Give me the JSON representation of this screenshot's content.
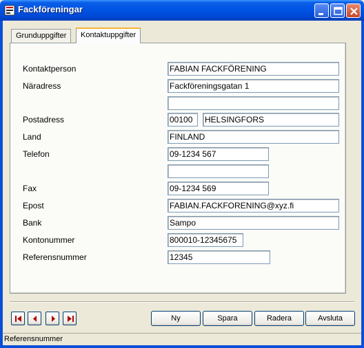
{
  "window": {
    "title": "Fackföreningar"
  },
  "tabs": [
    {
      "label": "Grunduppgifter"
    },
    {
      "label": "Kontaktuppgifter"
    }
  ],
  "form": {
    "contact_person_label": "Kontaktperson",
    "contact_person_value": "FABIAN FACKFÖRENING",
    "street_label": "Näradress",
    "street_value": "Fackföreningsgatan 1",
    "street2_value": "",
    "postal_label": "Postadress",
    "postal_code_value": "00100",
    "postal_city_value": "HELSINGFORS",
    "country_label": "Land",
    "country_value": "FINLAND",
    "phone_label": "Telefon",
    "phone_value": "09-1234 567",
    "phone2_value": "",
    "fax_label": "Fax",
    "fax_value": "09-1234 569",
    "email_label": "Epost",
    "email_value": "FABIAN.FACKFORENING@xyz.fi",
    "bank_label": "Bank",
    "bank_value": "Sampo",
    "account_label": "Kontonummer",
    "account_value": "800010-12345675",
    "reference_label": "Referensnummer",
    "reference_value": "12345"
  },
  "buttons": {
    "new": "Ny",
    "save": "Spara",
    "delete": "Radera",
    "exit": "Avsluta"
  },
  "nav_icons": [
    "first-record-icon",
    "previous-record-icon",
    "next-record-icon",
    "last-record-icon"
  ],
  "status": {
    "text": "Referensnummer"
  },
  "colors": {
    "titlebar": "#0054E3",
    "face": "#ECE9D8",
    "nav_arrow": "#B00000"
  }
}
